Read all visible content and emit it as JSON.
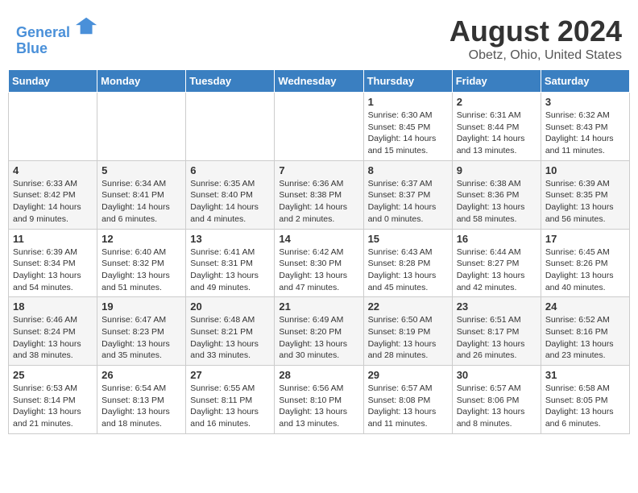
{
  "logo": {
    "line1": "General",
    "line2": "Blue"
  },
  "title": "August 2024",
  "subtitle": "Obetz, Ohio, United States",
  "days_of_week": [
    "Sunday",
    "Monday",
    "Tuesday",
    "Wednesday",
    "Thursday",
    "Friday",
    "Saturday"
  ],
  "weeks": [
    [
      {
        "day": "",
        "info": ""
      },
      {
        "day": "",
        "info": ""
      },
      {
        "day": "",
        "info": ""
      },
      {
        "day": "",
        "info": ""
      },
      {
        "day": "1",
        "info": "Sunrise: 6:30 AM\nSunset: 8:45 PM\nDaylight: 14 hours and 15 minutes."
      },
      {
        "day": "2",
        "info": "Sunrise: 6:31 AM\nSunset: 8:44 PM\nDaylight: 14 hours and 13 minutes."
      },
      {
        "day": "3",
        "info": "Sunrise: 6:32 AM\nSunset: 8:43 PM\nDaylight: 14 hours and 11 minutes."
      }
    ],
    [
      {
        "day": "4",
        "info": "Sunrise: 6:33 AM\nSunset: 8:42 PM\nDaylight: 14 hours and 9 minutes."
      },
      {
        "day": "5",
        "info": "Sunrise: 6:34 AM\nSunset: 8:41 PM\nDaylight: 14 hours and 6 minutes."
      },
      {
        "day": "6",
        "info": "Sunrise: 6:35 AM\nSunset: 8:40 PM\nDaylight: 14 hours and 4 minutes."
      },
      {
        "day": "7",
        "info": "Sunrise: 6:36 AM\nSunset: 8:38 PM\nDaylight: 14 hours and 2 minutes."
      },
      {
        "day": "8",
        "info": "Sunrise: 6:37 AM\nSunset: 8:37 PM\nDaylight: 14 hours and 0 minutes."
      },
      {
        "day": "9",
        "info": "Sunrise: 6:38 AM\nSunset: 8:36 PM\nDaylight: 13 hours and 58 minutes."
      },
      {
        "day": "10",
        "info": "Sunrise: 6:39 AM\nSunset: 8:35 PM\nDaylight: 13 hours and 56 minutes."
      }
    ],
    [
      {
        "day": "11",
        "info": "Sunrise: 6:39 AM\nSunset: 8:34 PM\nDaylight: 13 hours and 54 minutes."
      },
      {
        "day": "12",
        "info": "Sunrise: 6:40 AM\nSunset: 8:32 PM\nDaylight: 13 hours and 51 minutes."
      },
      {
        "day": "13",
        "info": "Sunrise: 6:41 AM\nSunset: 8:31 PM\nDaylight: 13 hours and 49 minutes."
      },
      {
        "day": "14",
        "info": "Sunrise: 6:42 AM\nSunset: 8:30 PM\nDaylight: 13 hours and 47 minutes."
      },
      {
        "day": "15",
        "info": "Sunrise: 6:43 AM\nSunset: 8:28 PM\nDaylight: 13 hours and 45 minutes."
      },
      {
        "day": "16",
        "info": "Sunrise: 6:44 AM\nSunset: 8:27 PM\nDaylight: 13 hours and 42 minutes."
      },
      {
        "day": "17",
        "info": "Sunrise: 6:45 AM\nSunset: 8:26 PM\nDaylight: 13 hours and 40 minutes."
      }
    ],
    [
      {
        "day": "18",
        "info": "Sunrise: 6:46 AM\nSunset: 8:24 PM\nDaylight: 13 hours and 38 minutes."
      },
      {
        "day": "19",
        "info": "Sunrise: 6:47 AM\nSunset: 8:23 PM\nDaylight: 13 hours and 35 minutes."
      },
      {
        "day": "20",
        "info": "Sunrise: 6:48 AM\nSunset: 8:21 PM\nDaylight: 13 hours and 33 minutes."
      },
      {
        "day": "21",
        "info": "Sunrise: 6:49 AM\nSunset: 8:20 PM\nDaylight: 13 hours and 30 minutes."
      },
      {
        "day": "22",
        "info": "Sunrise: 6:50 AM\nSunset: 8:19 PM\nDaylight: 13 hours and 28 minutes."
      },
      {
        "day": "23",
        "info": "Sunrise: 6:51 AM\nSunset: 8:17 PM\nDaylight: 13 hours and 26 minutes."
      },
      {
        "day": "24",
        "info": "Sunrise: 6:52 AM\nSunset: 8:16 PM\nDaylight: 13 hours and 23 minutes."
      }
    ],
    [
      {
        "day": "25",
        "info": "Sunrise: 6:53 AM\nSunset: 8:14 PM\nDaylight: 13 hours and 21 minutes."
      },
      {
        "day": "26",
        "info": "Sunrise: 6:54 AM\nSunset: 8:13 PM\nDaylight: 13 hours and 18 minutes."
      },
      {
        "day": "27",
        "info": "Sunrise: 6:55 AM\nSunset: 8:11 PM\nDaylight: 13 hours and 16 minutes."
      },
      {
        "day": "28",
        "info": "Sunrise: 6:56 AM\nSunset: 8:10 PM\nDaylight: 13 hours and 13 minutes."
      },
      {
        "day": "29",
        "info": "Sunrise: 6:57 AM\nSunset: 8:08 PM\nDaylight: 13 hours and 11 minutes."
      },
      {
        "day": "30",
        "info": "Sunrise: 6:57 AM\nSunset: 8:06 PM\nDaylight: 13 hours and 8 minutes."
      },
      {
        "day": "31",
        "info": "Sunrise: 6:58 AM\nSunset: 8:05 PM\nDaylight: 13 hours and 6 minutes."
      }
    ]
  ]
}
